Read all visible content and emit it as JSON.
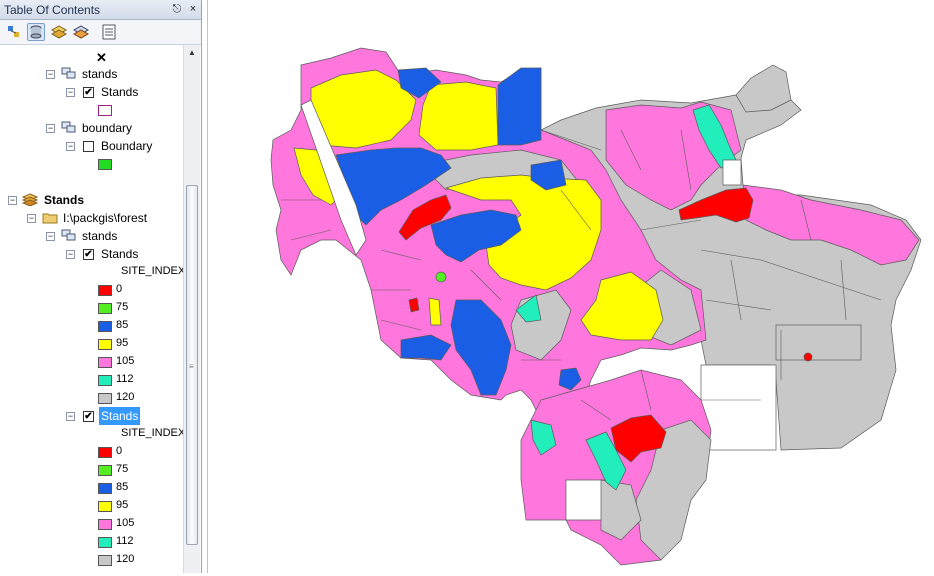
{
  "toc": {
    "title": "Table Of Contents",
    "pin_glyph": "⚓",
    "close_glyph": "×",
    "tools": [
      {
        "name": "list-by-drawing-order-icon"
      },
      {
        "name": "list-by-source-icon"
      },
      {
        "name": "list-by-visibility-icon"
      },
      {
        "name": "list-by-selection-icon"
      },
      {
        "name": "options-icon"
      }
    ],
    "remove_glyph": "✕",
    "items": {
      "stands_group_1": "stands",
      "stands_layer_1": "Stands",
      "boundary_group": "boundary",
      "boundary_layer": "Boundary",
      "data_frame": "Stands",
      "folder": "I:\\packgis\\forest",
      "stands_group_2": "stands",
      "stands_layer_2": "Stands",
      "field_1": "SITE_INDEX",
      "stands_layer_3": "Stands",
      "field_2": "SITE_INDEX"
    },
    "legend_values": [
      "0",
      "75",
      "85",
      "95",
      "105",
      "112",
      "120"
    ],
    "legend_colors": [
      "#ff0000",
      "#55ee22",
      "#1a5ee6",
      "#ffff00",
      "#ff77dd",
      "#22eebb",
      "#c8c8c8"
    ]
  },
  "map_colors": {
    "pink": "#ff77dd",
    "yellow": "#ffff00",
    "blue": "#1a5ee6",
    "red": "#ff0000",
    "cyan": "#22eebb",
    "gray": "#c8c8c8",
    "green": "#55ee22",
    "outline": "#5a5a5a"
  },
  "checks": {
    "checked": "✔"
  }
}
